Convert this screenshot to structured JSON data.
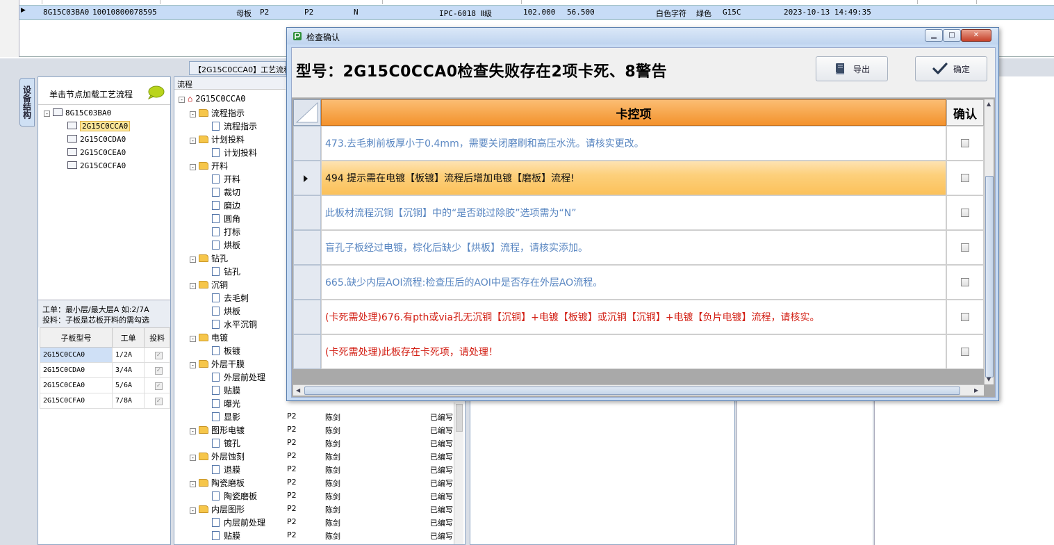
{
  "top_grid": {
    "row": [
      "8G15C03BA0",
      "10010800078595",
      "母板",
      "P2",
      "P2",
      "N",
      "IPC-6018 Ⅱ级",
      "102.000",
      "56.500",
      "白色字符",
      "绿色",
      "G15C",
      "2023-10-13 14:49:35"
    ]
  },
  "left_panel": {
    "side_tab": "设备结构",
    "header_text": "单击节点加载工艺流程",
    "tree_root": "8G15C03BA0",
    "tree_children": [
      "2G15C0CCA0",
      "2G15C0CDA0",
      "2G15C0CEA0",
      "2G15C0CFA0"
    ],
    "info_line1": "工单：最小层/最大层A 如:2/7A",
    "info_line2": "投料：子板是芯板开料的需勾选",
    "table_headers": [
      "子板型号",
      "工单",
      "投料"
    ],
    "table_rows": [
      {
        "model": "2G15C0CCA0",
        "order": "1/2A"
      },
      {
        "model": "2G15C0CDA0",
        "order": "3/4A"
      },
      {
        "model": "2G15C0CEA0",
        "order": "5/6A"
      },
      {
        "model": "2G15C0CFA0",
        "order": "7/8A"
      }
    ],
    "check_mark": "✓"
  },
  "flow_panel": {
    "tab_label": "【2G15C0CCA0】工艺流程",
    "column_head": "流程",
    "root": "2G15C0CCA0",
    "groups": [
      {
        "name": "流程指示",
        "children": [
          "流程指示"
        ]
      },
      {
        "name": "计划投料",
        "children": [
          "计划投料"
        ]
      },
      {
        "name": "开料",
        "children": [
          "开料",
          "裁切",
          "磨边",
          "圆角",
          "打标",
          "烘板"
        ]
      },
      {
        "name": "钻孔",
        "children": [
          "钻孔"
        ]
      },
      {
        "name": "沉铜",
        "children": [
          "去毛刺",
          "烘板",
          "水平沉铜"
        ]
      },
      {
        "name": "电镀",
        "children": [
          "板镀"
        ]
      },
      {
        "name": "外层干膜",
        "children": [
          "外层前处理",
          "贴膜",
          "曝光",
          "显影"
        ]
      },
      {
        "name": "图形电镀",
        "children": [
          "镀孔"
        ]
      },
      {
        "name": "外层蚀刻",
        "children": [
          "退膜"
        ]
      },
      {
        "name": "陶瓷磨板",
        "children": [
          "陶瓷磨板"
        ]
      },
      {
        "name": "内层图形",
        "children": [
          "内层前处理",
          "贴膜"
        ]
      }
    ],
    "grid_p2": "P2",
    "grid_person": "陈剑",
    "grid_status": "已编写"
  },
  "dialog": {
    "title": "检查确认",
    "heading": "型号：2G15C0CCA0检查失败存在2项卡死、8警告",
    "export_label": "导出",
    "ok_label": "确定",
    "col_main": "卡控项",
    "col_confirm": "确认",
    "rows": [
      {
        "text": "473.去毛刺前板厚小于0.4mm，需要关闭磨刷和高压水洗。请核实更改。",
        "color": "blue",
        "selected": false
      },
      {
        "text": "494 提示需在电镀【板镀】流程后增加电镀【磨板】流程!",
        "color": "black",
        "selected": true
      },
      {
        "text": "此板材流程沉铜【沉铜】中的“是否跳过除胶”选项需为“N”",
        "color": "blue",
        "selected": false
      },
      {
        "text": "盲孔子板经过电镀，棕化后缺少【烘板】流程，请核实添加。",
        "color": "blue",
        "selected": false
      },
      {
        "text": "665.缺少内层AOI流程:检查压后的AOI中是否存在外层AO流程。",
        "color": "blue",
        "selected": false
      },
      {
        "text": "(卡死需处理)676.有pth或via孔无沉铜【沉铜】+电镀【板镀】或沉铜【沉铜】+电镀【负片电镀】流程，请核实。",
        "color": "red",
        "selected": false
      },
      {
        "text": "(卡死需处理)此板存在卡死项，请处理！",
        "color": "red",
        "selected": false
      }
    ],
    "colors": {
      "blue": "#5a87c2",
      "black": "#111111",
      "red": "#d21d12",
      "header_orange": "#f3922c"
    }
  }
}
